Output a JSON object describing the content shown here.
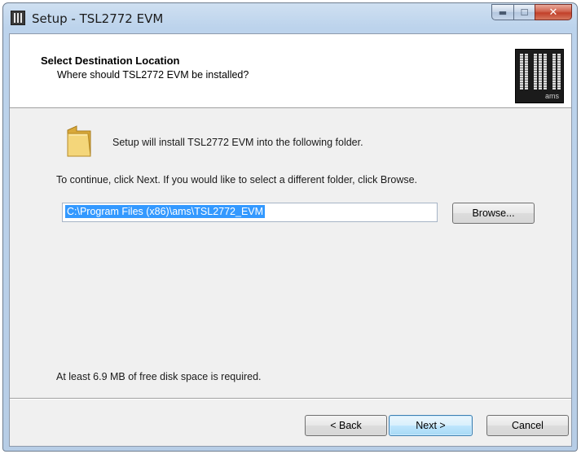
{
  "window": {
    "title": "Setup - TSL2772 EVM",
    "caption": {
      "minimize": "▬",
      "maximize": "☐",
      "close": "✕"
    }
  },
  "header": {
    "title": "Select Destination Location",
    "subtitle": "Where should TSL2772 EVM be installed?",
    "logo_brand": "ams"
  },
  "body": {
    "install_message": "Setup will install TSL2772 EVM into the following folder.",
    "continue_message": "To continue, click Next. If you would like to select a different folder, click Browse.",
    "destination_path": "C:\\Program Files (x86)\\ams\\TSL2772_EVM",
    "browse_label": "Browse...",
    "disk_space_message": "At least 6.9 MB of free disk space is required."
  },
  "footer": {
    "back_label": "< Back",
    "next_label": "Next >",
    "cancel_label": "Cancel"
  },
  "colors": {
    "selection": "#3399ff",
    "close_button": "#c2402a",
    "default_button_border": "#3c7fb1"
  },
  "icons": {
    "app": "installer-logo-icon",
    "folder": "folder-icon"
  }
}
